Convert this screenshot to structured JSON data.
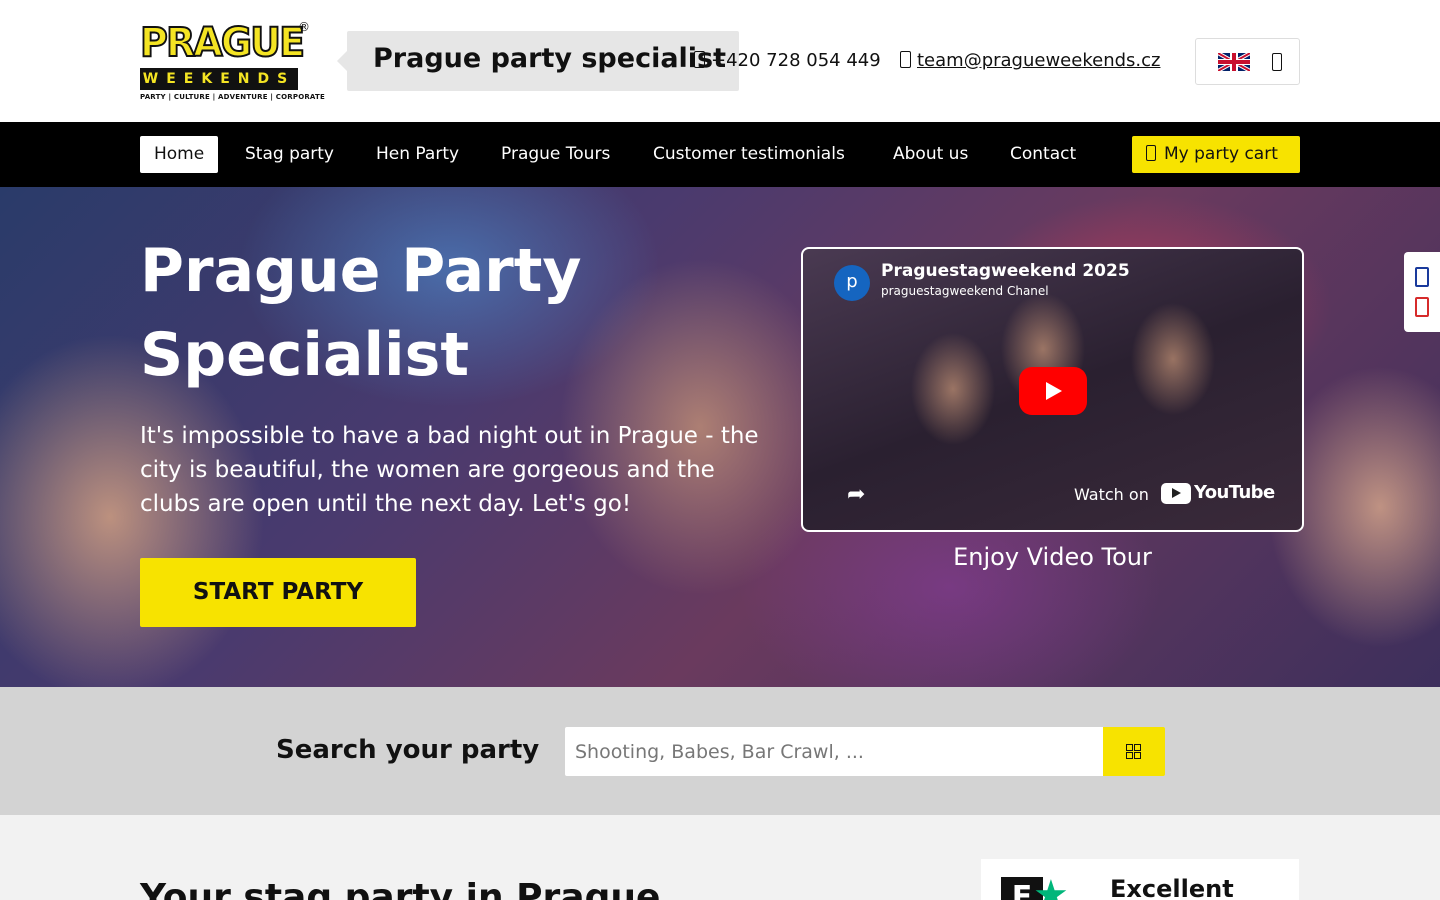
{
  "header": {
    "logo": {
      "main": "PRAGUE",
      "sub": "WEEKENDS",
      "tagline": "PARTY | CULTURE | ADVENTURE | CORPORATE",
      "reg": "®"
    },
    "bubble_text": "Prague party specialist",
    "phone": "+420 728 054 449",
    "email": "team@pragueweekends.cz",
    "language": "English"
  },
  "nav": {
    "items": [
      {
        "label": "Home",
        "active": true
      },
      {
        "label": "Stag party"
      },
      {
        "label": "Hen Party"
      },
      {
        "label": "Prague Tours"
      },
      {
        "label": "Customer testimonials"
      },
      {
        "label": "About us"
      },
      {
        "label": "Contact"
      }
    ],
    "cart_label": "My party cart"
  },
  "hero": {
    "title": "Prague Party Specialist",
    "text": "It's impossible to have a bad night out in Prague - the city is beautiful, the women are gorgeous and the clubs are open until the next day. Let's go!",
    "cta": "START PARTY",
    "video": {
      "avatar_letter": "p",
      "title": "Praguestagweekend 2025",
      "channel": "praguestagweekend Chanel",
      "watch_on": "Watch on",
      "brand": "YouTube"
    },
    "video_caption": "Enjoy Video Tour"
  },
  "search": {
    "label": "Search your party",
    "placeholder": "Shooting, Babes, Bar Crawl, ..."
  },
  "below": {
    "title": "Your stag party in Prague",
    "trustpilot_rating": "Excellent",
    "trustpilot_letter": "E"
  },
  "colors": {
    "accent": "#f7e300",
    "nav_bg": "#000000",
    "youtube_red": "#ff0000",
    "trustpilot_green": "#00b67a"
  }
}
